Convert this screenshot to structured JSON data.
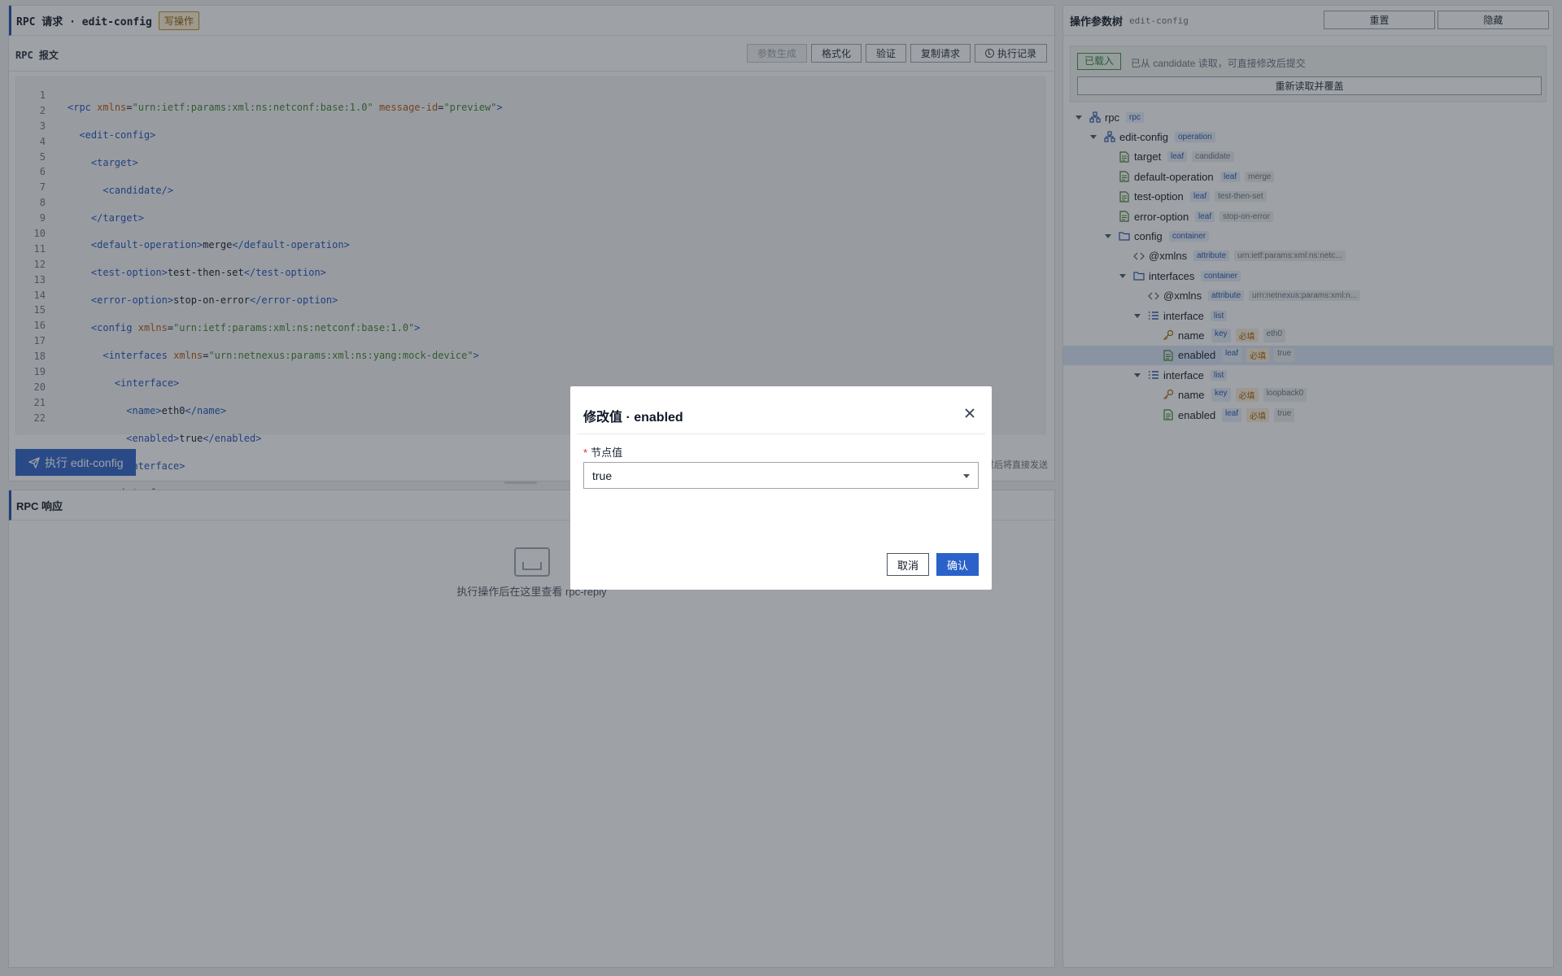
{
  "request_panel": {
    "title": "RPC 请求 · edit-config",
    "badge": "写操作",
    "message_title": "RPC 报文",
    "toolbar": {
      "generate": "参数生成",
      "format": "格式化",
      "validate": "验证",
      "copy": "复制请求",
      "history": "执行记录"
    },
    "line_numbers": [
      "1",
      "2",
      "3",
      "4",
      "5",
      "6",
      "7",
      "8",
      "9",
      "10",
      "11",
      "12",
      "13",
      "14",
      "15",
      "16",
      "17",
      "18",
      "19",
      "20",
      "21",
      "22"
    ],
    "execute_button": "执行 edit-config",
    "execute_hint": "过后将直接发送"
  },
  "response_panel": {
    "title": "RPC 响应",
    "empty_text": "执行操作后在这里查看 rpc-reply"
  },
  "tree_panel": {
    "title": "操作参数树",
    "subtitle": "edit-config",
    "reset": "重置",
    "hide": "隐藏",
    "loaded_tag": "已载入",
    "loaded_desc": "已从 candidate 读取，可直接修改后提交",
    "reload": "重新读取并覆盖",
    "nodes": [
      {
        "label": "rpc",
        "type": "rpc",
        "required": "",
        "value": "",
        "icon": "hierarchy-icon"
      },
      {
        "label": "edit-config",
        "type": "operation",
        "required": "",
        "value": "",
        "icon": "hierarchy-icon"
      },
      {
        "label": "target",
        "type": "leaf",
        "required": "",
        "value": "candidate",
        "icon": "document-icon"
      },
      {
        "label": "default-operation",
        "type": "leaf",
        "required": "",
        "value": "merge",
        "icon": "document-icon"
      },
      {
        "label": "test-option",
        "type": "leaf",
        "required": "",
        "value": "test-then-set",
        "icon": "document-icon"
      },
      {
        "label": "error-option",
        "type": "leaf",
        "required": "",
        "value": "stop-on-error",
        "icon": "document-icon"
      },
      {
        "label": "config",
        "type": "container",
        "required": "",
        "value": "",
        "icon": "folder-icon"
      },
      {
        "label": "@xmlns",
        "type": "attribute",
        "required": "",
        "value": "urn:ietf:params:xml:ns:netc...",
        "icon": "code-icon"
      },
      {
        "label": "interfaces",
        "type": "container",
        "required": "",
        "value": "",
        "icon": "folder-icon"
      },
      {
        "label": "@xmlns",
        "type": "attribute",
        "required": "",
        "value": "urn:netnexus:params:xml:n...",
        "icon": "code-icon"
      },
      {
        "label": "interface",
        "type": "list",
        "required": "",
        "value": "",
        "icon": "list-icon"
      },
      {
        "label": "name",
        "type": "key",
        "required": "必填",
        "value": "eth0",
        "icon": "key-icon"
      },
      {
        "label": "enabled",
        "type": "leaf",
        "required": "必填",
        "value": "true",
        "icon": "document-icon"
      },
      {
        "label": "interface",
        "type": "list",
        "required": "",
        "value": "",
        "icon": "list-icon"
      },
      {
        "label": "name",
        "type": "key",
        "required": "必填",
        "value": "loopback0",
        "icon": "key-icon"
      },
      {
        "label": "enabled",
        "type": "leaf",
        "required": "必填",
        "value": "true",
        "icon": "document-icon"
      }
    ]
  },
  "modal": {
    "title": "修改值 · enabled",
    "field_label": "节点值",
    "required_mark": "*",
    "selected_value": "true",
    "cancel": "取消",
    "confirm": "确认"
  }
}
